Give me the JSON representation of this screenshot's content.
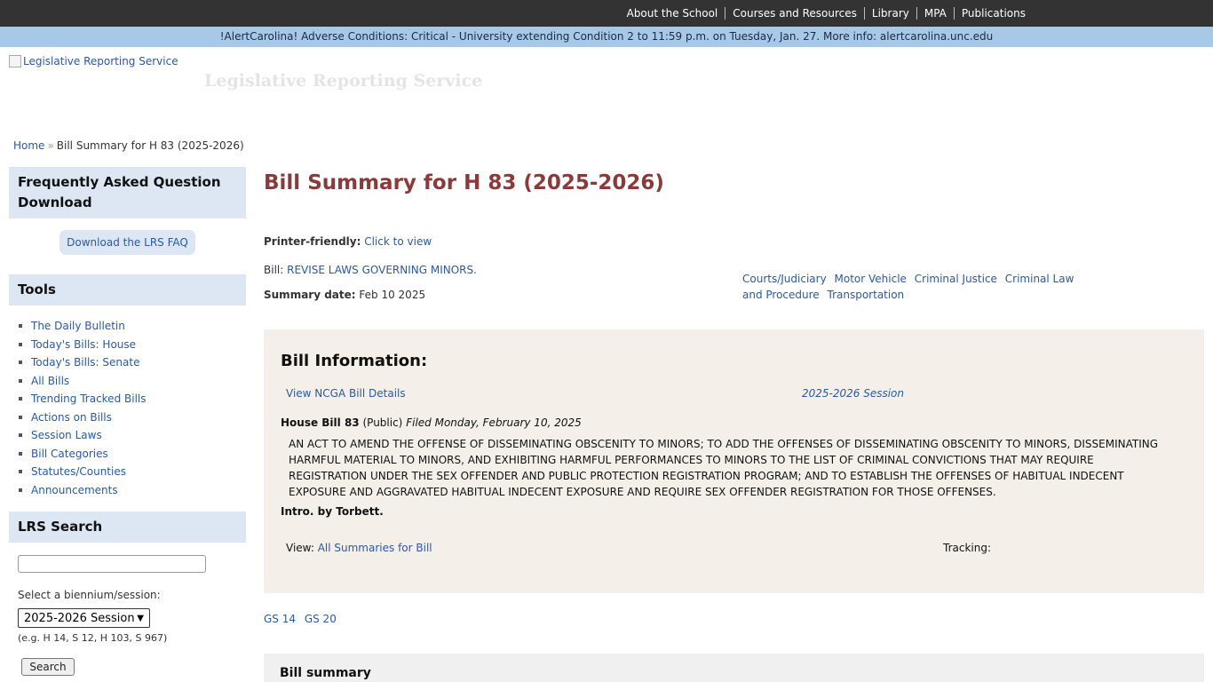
{
  "topnav": [
    "About the School",
    "Courses and Resources",
    "Library",
    "MPA",
    "Publications"
  ],
  "alert": "!AlertCarolina! Adverse Conditions: Critical - University extending Condition 2 to 11:59 p.m. on Tuesday, Jan. 27. More info: alertcarolina.unc.edu",
  "logo_alt": "Legislative Reporting Service",
  "site_name": "Legislative Reporting Service",
  "breadcrumb": {
    "home": "Home",
    "sep": "»",
    "current": "Bill Summary for H 83 (2025-2026)"
  },
  "sidebar": {
    "faq_title": "Frequently Asked Question Download",
    "faq_button": "Download the LRS FAQ",
    "tools_title": "Tools",
    "tools": [
      "The Daily Bulletin",
      "Today's Bills: House",
      "Today's Bills: Senate",
      "All Bills",
      "Trending Tracked Bills",
      "Actions on Bills",
      "Session Laws",
      "Bill Categories",
      "Statutes/Counties",
      "Announcements"
    ],
    "search_title": "LRS Search",
    "search_value": "",
    "select_label": "Select a biennium/session:",
    "select_value": "2025-2026 Session",
    "hint": "(e.g. H 14, S 12, H 103, S 967)",
    "search_button": "Search"
  },
  "main": {
    "title": "Bill Summary for H 83 (2025-2026)",
    "printer_label": "Printer-friendly:",
    "printer_link": "Click to view",
    "bill_label": "Bill:",
    "bill_link": "REVISE LAWS GOVERNING MINORS.",
    "summary_date_label": "Summary date:",
    "summary_date": "Feb 10 2025",
    "tags": [
      "Courts/Judiciary",
      "Motor Vehicle",
      "Criminal Justice",
      "Criminal Law and Procedure",
      "Transportation"
    ],
    "info": {
      "heading": "Bill Information:",
      "ncga_link": "View NCGA Bill Details",
      "session": "2025-2026 Session",
      "house_bill": "House Bill 83",
      "public": "(Public)",
      "filed": "Filed Monday, February 10, 2025",
      "act": "AN ACT TO AMEND THE OFFENSE OF DISSEMINATING OBSCENITY TO MINORS; TO ADD THE OFFENSES OF DISSEMINATING OBSCENITY TO MINORS, DISSEMINATING HARMFUL MATERIAL TO MINORS, AND EXHIBITING HARMFUL PERFORMANCES TO MINORS TO THE LIST OF CRIMINAL CONVICTIONS THAT MAY REQUIRE REGISTRATION UNDER THE SEX OFFENDER AND PUBLIC PROTECTION REGISTRATION PROGRAM; AND TO ESTABLISH THE OFFENSES OF HABITUAL INDECENT EXPOSURE AND AGGRAVATED HABITUAL INDECENT EXPOSURE AND REQUIRE SEX OFFENDER REGISTRATION FOR THOSE OFFENSES.",
      "intro": "Intro. by Torbett.",
      "view_label": "View:",
      "view_link": "All Summaries for Bill",
      "tracking": "Tracking:"
    },
    "gs": [
      "GS 14",
      "GS 20"
    ],
    "summary_heading": "Bill summary"
  }
}
